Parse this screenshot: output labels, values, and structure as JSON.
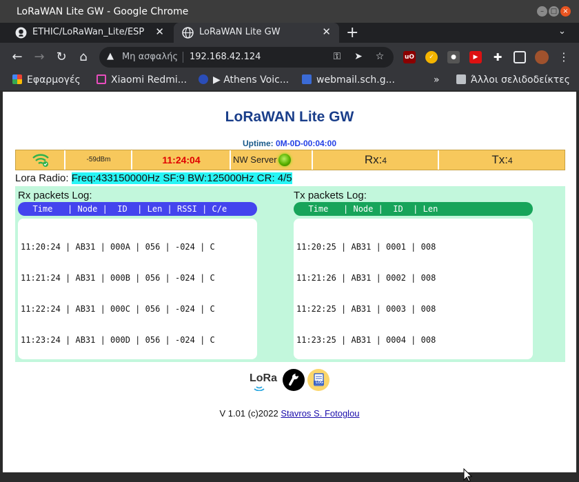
{
  "window": {
    "title": "LoRaWAN Lite GW - Google Chrome"
  },
  "tabs": [
    {
      "label": "ETHIC/LoRaWan_Lite/ESP",
      "icon": "github-icon",
      "active": false
    },
    {
      "label": "LoRaWAN Lite GW",
      "icon": "globe-icon",
      "active": true
    }
  ],
  "toolbar": {
    "security_label": "Μη ασφαλής",
    "url": "192.168.42.124"
  },
  "bookmarks": {
    "apps": "Εφαρμογές",
    "items": [
      "Xiaomi Redmi...",
      "▶ Athens Voic...",
      "webmail.sch.g..."
    ],
    "other": "Άλλοι σελιδοδείκτες"
  },
  "page": {
    "title": "LoRaWAN Lite GW",
    "uptime_label": "Uptime:",
    "uptime_value": "0M-0D-00:04:00",
    "rssi": "-59dBm",
    "clock": "11:24:04",
    "nw_server": "NW Server",
    "rx_label": "Rx:",
    "rx_count": "4",
    "tx_label": "Tx:",
    "tx_count": "4",
    "radio_label": "Lora Radio:",
    "radio_value": "Freq:433150000Hz SF:9 BW:125000Hz CR: 4/5",
    "rx_log_title": "Rx packets Log:",
    "rx_header": "  Time   | Node |  ID  | Len | RSSI | C/e",
    "rx_rows": [
      "11:20:24 | AB31 | 000A | 056 | -024 | C",
      "11:21:24 | AB31 | 000B | 056 | -024 | C",
      "11:22:24 | AB31 | 000C | 056 | -024 | C",
      "11:23:24 | AB31 | 000D | 056 | -024 | C"
    ],
    "tx_log_title": "Tx packets Log:",
    "tx_header": "  Time   | Node |  ID  | Len",
    "tx_rows": [
      "11:20:25 | AB31 | 0001 | 008",
      "11:21:26 | AB31 | 0002 | 008",
      "11:22:25 | AB31 | 0003 | 008",
      "11:23:25 | AB31 | 0004 | 008"
    ],
    "logo_text": "LoRa",
    "log_badge": "LOG",
    "footer_text": "V 1.01 (c)2022",
    "footer_link": "Stavros S. Fotoglou"
  },
  "colors": {
    "rx_header": "#4444ee",
    "tx_header": "#17a45a",
    "panel_bg": "#c2f7dc",
    "status_bg": "#f7c85c",
    "radio_highlight": "#29f5f5"
  }
}
